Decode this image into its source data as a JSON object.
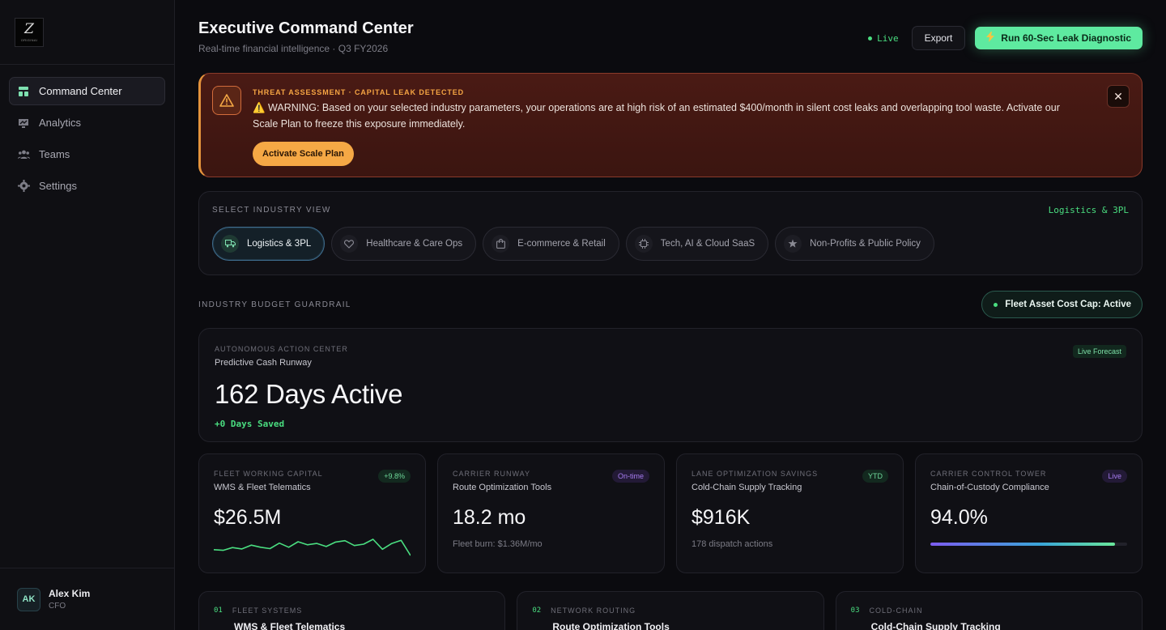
{
  "brand": {
    "logo_letter": "Z",
    "logo_caption": "ORIGINAI"
  },
  "sidebar": {
    "items": [
      {
        "label": "Command Center",
        "icon": "grid-icon",
        "active": true
      },
      {
        "label": "Analytics",
        "icon": "chart-icon",
        "active": false
      },
      {
        "label": "Teams",
        "icon": "users-icon",
        "active": false
      },
      {
        "label": "Settings",
        "icon": "gear-icon",
        "active": false
      }
    ],
    "user": {
      "initials": "AK",
      "name": "Alex Kim",
      "role": "CFO"
    }
  },
  "header": {
    "title": "Executive Command Center",
    "subtitle": "Real-time financial intelligence · Q3 FY2026",
    "live_label": "Live",
    "export_label": "Export",
    "diagnostic_label": "Run 60-Sec Leak Diagnostic"
  },
  "alert": {
    "kicker": "THREAT ASSESSMENT · CAPITAL LEAK DETECTED",
    "message": "⚠️ WARNING: Based on your selected industry parameters, your operations are at high risk of an estimated $400/month in silent cost leaks and overlapping tool waste. Activate our Scale Plan to freeze this exposure immediately.",
    "action_label": "Activate Scale Plan",
    "close_label": "✕"
  },
  "industry": {
    "heading": "SELECT INDUSTRY VIEW",
    "current": "Logistics & 3PL",
    "options": [
      {
        "label": "Logistics & 3PL",
        "icon": "truck-icon",
        "active": true
      },
      {
        "label": "Healthcare & Care Ops",
        "icon": "heart-icon",
        "active": false
      },
      {
        "label": "E-commerce & Retail",
        "icon": "bag-icon",
        "active": false
      },
      {
        "label": "Tech, AI & Cloud SaaS",
        "icon": "chip-icon",
        "active": false
      },
      {
        "label": "Non-Profits & Public Policy",
        "icon": "star-icon",
        "active": false
      }
    ]
  },
  "guardrail": {
    "heading": "INDUSTRY BUDGET GUARDRAIL",
    "badge": "Fleet Asset Cost Cap: Active"
  },
  "runway": {
    "kicker": "AUTONOMOUS ACTION CENTER",
    "title": "Predictive Cash Runway",
    "value": "162 Days Active",
    "saved": "+0 Days Saved",
    "badge": "Live Forecast"
  },
  "metrics": [
    {
      "kicker": "FLEET WORKING CAPITAL",
      "title": "WMS & Fleet Telematics",
      "value": "$26.5M",
      "badge": "+9.8%",
      "badge_color": "green",
      "sparkline": [
        8,
        7.6,
        9.2,
        8.4,
        10.6,
        9.4,
        8.6,
        11.8,
        9.4,
        12.6,
        10.8,
        11.6,
        9.8,
        12.4,
        13.2,
        10.4,
        11.2,
        14,
        8.2,
        11.6,
        13.4,
        4.6
      ]
    },
    {
      "kicker": "CARRIER RUNWAY",
      "title": "Route Optimization Tools",
      "value": "18.2 mo",
      "badge": "On-time",
      "badge_color": "purple",
      "note": "Fleet burn: $1.36M/mo"
    },
    {
      "kicker": "LANE OPTIMIZATION SAVINGS",
      "title": "Cold-Chain Supply Tracking",
      "value": "$916K",
      "badge": "YTD",
      "badge_color": "green",
      "note": "178 dispatch actions"
    },
    {
      "kicker": "CARRIER CONTROL TOWER",
      "title": "Chain-of-Custody Compliance",
      "value": "94.0%",
      "badge": "Live",
      "badge_color": "purple",
      "progress": 0.94
    }
  ],
  "bottom": [
    {
      "num": "01",
      "kicker": "FLEET SYSTEMS",
      "title": "WMS & Fleet Telematics"
    },
    {
      "num": "02",
      "kicker": "NETWORK ROUTING",
      "title": "Route Optimization Tools"
    },
    {
      "num": "03",
      "kicker": "COLD-CHAIN",
      "title": "Cold-Chain Supply Tracking"
    }
  ],
  "colors": {
    "accent": "#4ade80",
    "alert": "#f5a845",
    "purple": "#a77cf0"
  }
}
